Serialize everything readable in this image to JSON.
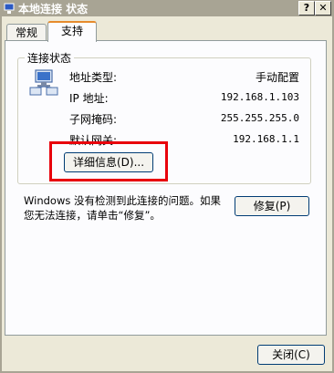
{
  "window": {
    "title": "本地连接 状态",
    "help_label": "?",
    "close_label": "✕"
  },
  "tabs": [
    {
      "label": "常规",
      "active": false
    },
    {
      "label": "支持",
      "active": true
    }
  ],
  "connection_status": {
    "legend": "连接状态",
    "rows": [
      {
        "label": "地址类型:",
        "value": "手动配置"
      },
      {
        "label": "IP 地址:",
        "value": "192.168.1.103"
      },
      {
        "label": "子网掩码:",
        "value": "255.255.255.0"
      },
      {
        "label": "默认网关:",
        "value": "192.168.1.1"
      }
    ],
    "details_button": "详细信息(D)..."
  },
  "message": {
    "line1": "Windows 没有检测到此连接的问题。如果",
    "line2": "您无法连接，请单击“修复”。"
  },
  "repair_button": "修复(P)",
  "close_button": "关闭(C)",
  "colors": {
    "title_bar": "#a8a494",
    "dialog_bg": "#ece9d8",
    "highlight_box": "#e8000b"
  }
}
